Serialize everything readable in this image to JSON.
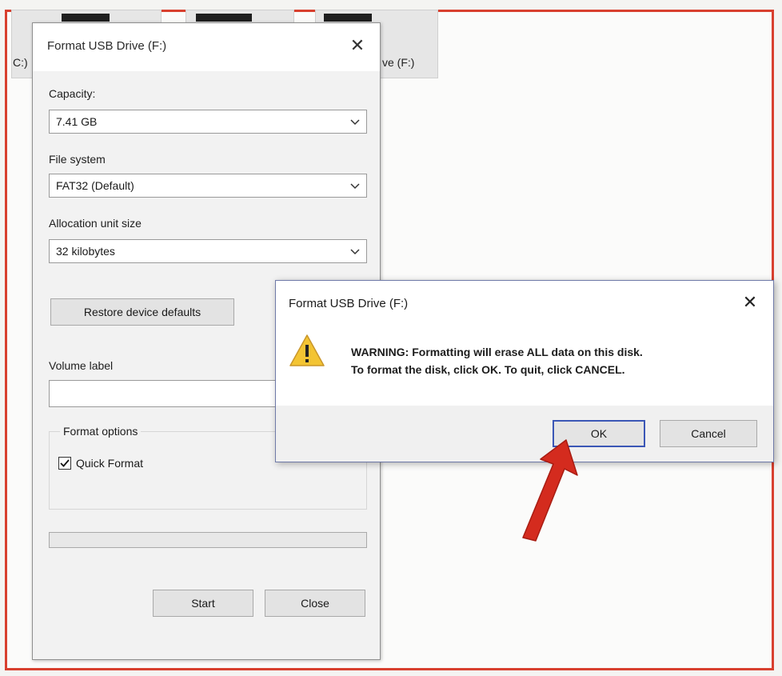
{
  "background": {
    "drive_c_label": "C:)",
    "drive_f_label": "ve (F:)"
  },
  "format_dialog": {
    "title": "Format USB Drive (F:)",
    "close_glyph": "✕",
    "capacity_label": "Capacity:",
    "capacity_value": "7.41 GB",
    "file_system_label": "File system",
    "file_system_value": "FAT32 (Default)",
    "allocation_label": "Allocation unit size",
    "allocation_value": "32 kilobytes",
    "restore_button": "Restore device defaults",
    "volume_label": "Volume label",
    "volume_value": "",
    "format_options_label": "Format options",
    "quick_format_label": "Quick Format",
    "quick_format_checked": true,
    "progress": 0,
    "start_button": "Start",
    "close_button": "Close"
  },
  "warning_dialog": {
    "title": "Format USB Drive (F:)",
    "close_glyph": "✕",
    "message_line1": "WARNING: Formatting will erase ALL data on this disk.",
    "message_line2": "To format the disk, click OK. To quit, click CANCEL.",
    "icon": "warning-icon",
    "ok_button": "OK",
    "cancel_button": "Cancel"
  },
  "colors": {
    "frame_border": "#d8402f",
    "annotation_arrow": "#d42b1e",
    "focus_border": "#3b57b6"
  }
}
